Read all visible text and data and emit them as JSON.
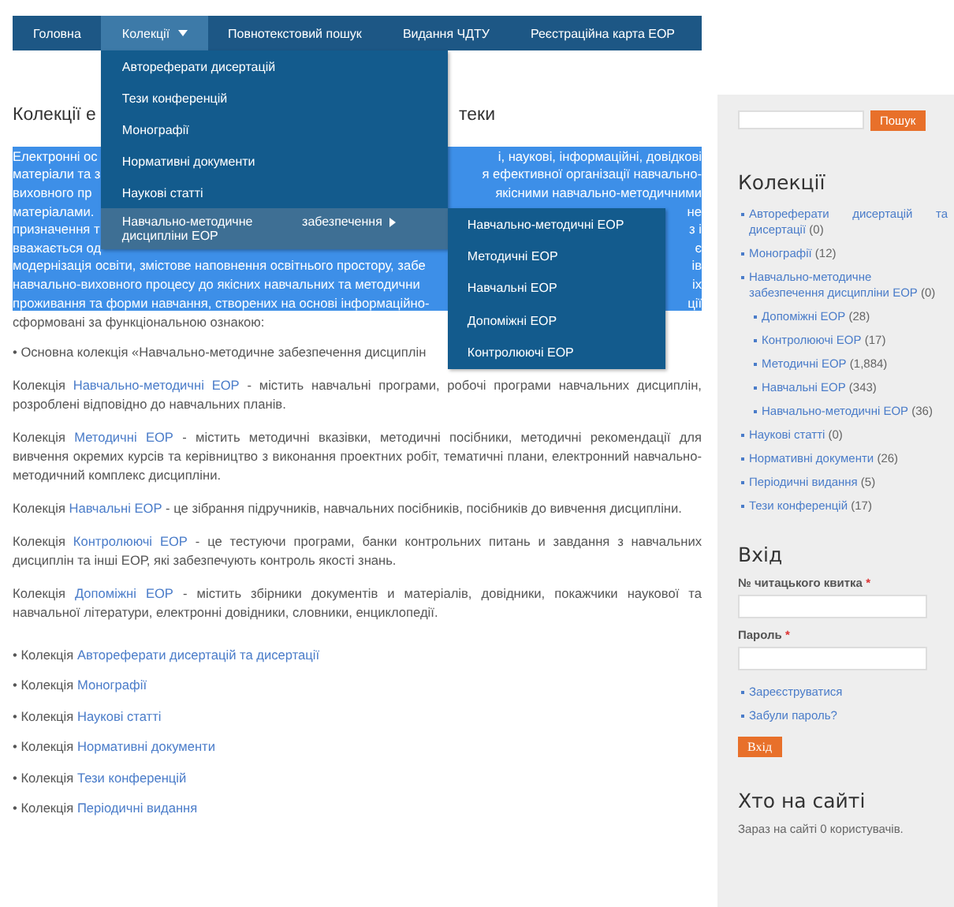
{
  "nav": {
    "items": [
      {
        "label": "Головна",
        "selected": false,
        "has_menu": false
      },
      {
        "label": "Колекції",
        "selected": true,
        "has_menu": true
      },
      {
        "label": "Повнотекстовий пошук",
        "selected": false,
        "has_menu": false
      },
      {
        "label": "Видання ЧДТУ",
        "selected": false,
        "has_menu": false
      },
      {
        "label": "Реєстраційна карта ЕОР",
        "selected": false,
        "has_menu": false
      }
    ]
  },
  "menu": {
    "items": [
      {
        "label": "Автореферати дисертацій",
        "selected": false
      },
      {
        "label": "Тези конференцій",
        "selected": false
      },
      {
        "label": "Монографії",
        "selected": false
      },
      {
        "label": "Нормативні документи",
        "selected": false
      },
      {
        "label": "Наукові статті",
        "selected": false
      },
      {
        "label": "Навчально-методичне забезпечення дисципліни ЕОР",
        "selected": true,
        "expanded": true,
        "children": [
          {
            "label": "Навчально-методичні ЕОР"
          },
          {
            "label": "Методичні ЕОР"
          },
          {
            "label": "Навчальні ЕОР"
          },
          {
            "label": "Допоміжні ЕОР"
          },
          {
            "label": "Контролюючі ЕОР"
          }
        ]
      }
    ]
  },
  "main": {
    "heading_parts": [
      "Колекції е",
      "теки"
    ],
    "intro": {
      "selected": true,
      "lines": [
        {
          "left": "Електронні ос",
          "right": "і, наукові, інформаційні, довідкові"
        },
        {
          "left": "матеріали та з",
          "right": "я ефективної організації навчально-"
        },
        {
          "left": "виховного пр",
          "right": "якісними навчально-методичними"
        },
        {
          "left": "матеріалами.",
          "right": "не"
        },
        {
          "left": "призначення т",
          "right": "з і"
        },
        {
          "left": "вважається од",
          "right": "є"
        },
        {
          "left": "модернізація освіти, змістове наповнення освітнього простору, забе",
          "right": "ів"
        },
        {
          "left": "навчально-виховного процесу до якісних навчальних та методични",
          "right": "іх"
        },
        {
          "left": "проживання та форми навчання, створених на основі інформаційно-",
          "right": "ції"
        }
      ]
    },
    "intro_tail": "сформовані за функціональною ознакою:",
    "main_collection": "• Основна колекція «Навчально-методичне забезпечення дисциплін",
    "descriptions": [
      {
        "lead": "Колекція",
        "link": "Навчально-методичні ЕОР",
        "tail": "- містить навчальні програми, робочі програми навчальних дисциплін, розроблені відповідно до навчальних планів."
      },
      {
        "lead": "Колекція",
        "link": "Методичні ЕОР",
        "tail": "- містить методичні вказівки, методичні посібники, методичні рекомендації для вивчення окремих курсів та керівництво з виконання проектних робіт, тематичні плани, електронний навчально-методичний комплекс дисципліни."
      },
      {
        "lead": "Колекція",
        "link": "Навчальні ЕОР",
        "tail": "- це зібрання підручників, навчальних посібників, посібників до вивчення дисципліни."
      },
      {
        "lead": "Колекція",
        "link": "Контролюючі ЕОР",
        "tail": "- це тестуючи програми, банки контрольних питань и завдання з навчальних дисциплін та інші ЕОР, які забезпечують контроль якості знань."
      },
      {
        "lead": "Колекція",
        "link": "Допоміжні ЕОР",
        "tail": "- містить збірники документів и матеріалів, довідники, покажчики наукової та навчальної літератури, електронні довідники, словники, енциклопедії."
      }
    ],
    "collections": [
      {
        "lead": "• Колекція",
        "link": "Автореферати дисертацій та дисертації"
      },
      {
        "lead": "• Колекція",
        "link": "Монографії"
      },
      {
        "lead": "• Колекція",
        "link": "Наукові статті"
      },
      {
        "lead": "• Колекція",
        "link": "Нормативні документи"
      },
      {
        "lead": "• Колекція",
        "link": "Тези конференцій"
      },
      {
        "lead": "• Колекція",
        "link": "Періодичні видання"
      }
    ]
  },
  "sidebar": {
    "search_button": "Пошук",
    "collections_title": "Колекції",
    "collections": [
      {
        "label": "Автореферати дисертацій та дисертації",
        "count": "(0)"
      },
      {
        "label": "Монографії",
        "count": "(12)"
      },
      {
        "label": "Навчально-методичне забезпечення дисципліни ЕОР",
        "count": "(0)",
        "children": [
          {
            "label": "Допоміжні ЕОР",
            "count": "(28)"
          },
          {
            "label": "Контролюючі ЕОР",
            "count": "(17)"
          },
          {
            "label": "Методичні ЕОР",
            "count": "(1,884)"
          },
          {
            "label": "Навчальні ЕОР",
            "count": "(343)"
          },
          {
            "label": "Навчально-методичні ЕОР",
            "count": "(36)"
          }
        ]
      },
      {
        "label": "Наукові статті",
        "count": "(0)"
      },
      {
        "label": "Нормативні документи",
        "count": "(26)"
      },
      {
        "label": "Періодичні видання",
        "count": "(5)"
      },
      {
        "label": "Тези конференцій",
        "count": "(17)"
      }
    ],
    "login": {
      "title": "Вхід",
      "fields": [
        {
          "label": "№ читацького квитка",
          "required": "*"
        },
        {
          "label": "Пароль",
          "required": "*"
        }
      ],
      "links": [
        "Зареєструватися",
        "Забули пароль?"
      ],
      "button": "Вхід"
    },
    "online": {
      "title": "Хто на сайті",
      "text": "Зараз на сайті 0 користувачів."
    }
  }
}
